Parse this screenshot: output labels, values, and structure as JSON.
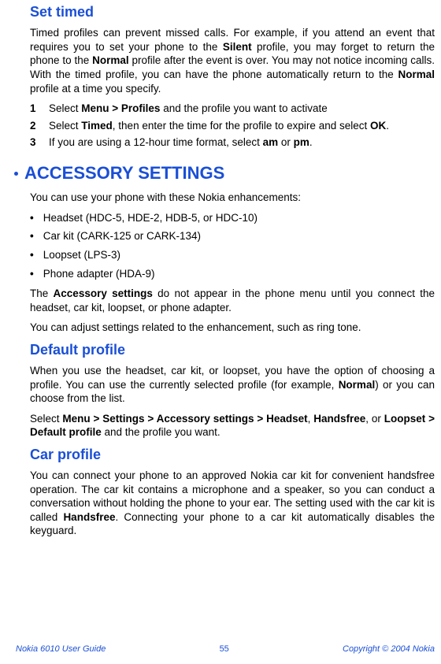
{
  "set_timed": {
    "title": "Set timed",
    "intro_parts": [
      "Timed profiles can prevent missed calls. For example, if you attend an event that requires you to set your phone to the ",
      "Silent",
      " profile, you may forget to return the phone to the ",
      "Normal",
      " profile after the event is over. You may not notice incoming calls. With the timed profile, you can have the phone automatically return to the ",
      "Normal",
      " profile at a time you specify."
    ],
    "steps": [
      {
        "num": "1",
        "pre": "Select ",
        "b1": "Menu > Profiles",
        "post": " and the profile you want to activate"
      },
      {
        "num": "2",
        "pre": "Select ",
        "b1": "Timed",
        "mid": ", then enter the time for the profile to expire and select ",
        "b2": "OK",
        "post": "."
      },
      {
        "num": "3",
        "pre": "If you are using a 12-hour time format, select ",
        "b1": "am",
        "mid": " or ",
        "b2": "pm",
        "post": "."
      }
    ]
  },
  "accessory": {
    "title": "ACCESSORY SETTINGS",
    "intro": "You can use your phone with these Nokia enhancements:",
    "items": [
      "Headset (HDC-5, HDE-2, HDB-5, or HDC-10)",
      "Car kit (CARK-125 or CARK-134)",
      "Loopset (LPS-3)",
      "Phone adapter (HDA-9)"
    ],
    "note_parts": [
      "The ",
      "Accessory settings",
      " do not appear in the phone menu until you connect the headset, car kit, loopset, or phone adapter."
    ],
    "adjust": "You can adjust settings related to the enhancement, such as ring tone."
  },
  "default_profile": {
    "title": "Default profile",
    "desc_parts": [
      "When you use the headset, car kit, or loopset, you have the option of choosing a profile. You can use the currently selected profile (for example, ",
      "Normal",
      ") or you can choose from the list."
    ],
    "select_parts": [
      "Select ",
      "Menu > Settings > Accessory settings > Headset",
      ", ",
      "Handsfree",
      ", or ",
      "Loopset > Default profile",
      " and the profile you want."
    ]
  },
  "car_profile": {
    "title": "Car profile",
    "desc_parts": [
      "You can connect your phone to an approved Nokia car kit for convenient handsfree operation. The car kit contains a microphone and a speaker, so you can conduct a conversation without holding the phone to your ear. The setting used with the car kit is called ",
      "Handsfree",
      ". Connecting your phone to a car kit automatically disables the keyguard."
    ]
  },
  "footer": {
    "left": "Nokia 6010 User Guide",
    "page": "55",
    "right": "Copyright © 2004 Nokia"
  }
}
